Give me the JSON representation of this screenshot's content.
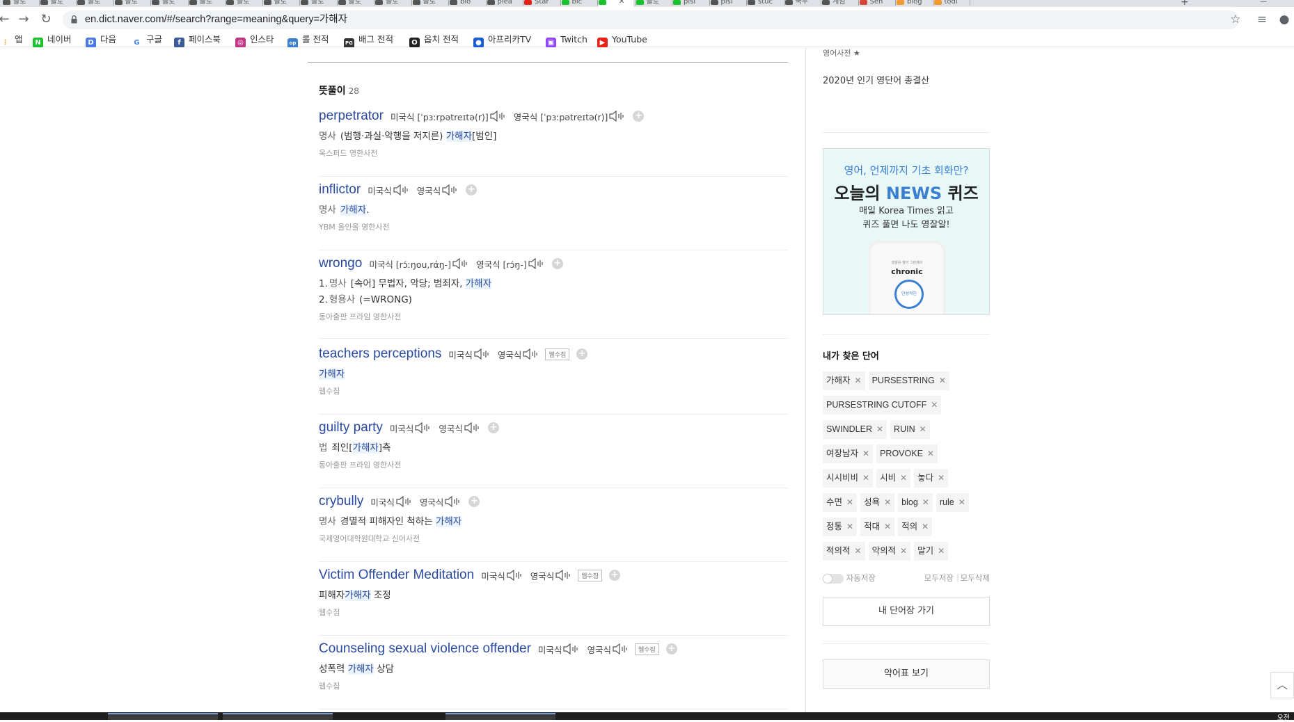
{
  "browser": {
    "tabs": [
      {
        "label": "블로",
        "color": "#555555"
      },
      {
        "label": "블로",
        "color": "#555555"
      },
      {
        "label": "블로",
        "color": "#555555"
      },
      {
        "label": "블로",
        "color": "#555555"
      },
      {
        "label": "블로",
        "color": "#555555"
      },
      {
        "label": "블로",
        "color": "#555555"
      },
      {
        "label": "블로",
        "color": "#555555"
      },
      {
        "label": "블로",
        "color": "#555555"
      },
      {
        "label": "블로",
        "color": "#555555"
      },
      {
        "label": "블로",
        "color": "#555555"
      },
      {
        "label": "블로",
        "color": "#555555"
      },
      {
        "label": "블로",
        "color": "#555555"
      },
      {
        "label": "blo",
        "color": "#555555"
      },
      {
        "label": "plea",
        "color": "#555555"
      },
      {
        "label": "Star",
        "color": "#e62117"
      },
      {
        "label": "blc",
        "color": "#19c22e"
      },
      {
        "label": "",
        "color": "#19c22e"
      },
      {
        "label": "블로",
        "color": "#19c22e"
      },
      {
        "label": "plsi",
        "color": "#19c22e"
      },
      {
        "label": "plsi",
        "color": "#555555"
      },
      {
        "label": "stuc",
        "color": "#555555"
      },
      {
        "label": "국무",
        "color": "#555555"
      },
      {
        "label": "계엄",
        "color": "#555555"
      },
      {
        "label": "Sen",
        "color": "#d44638"
      },
      {
        "label": "blog",
        "color": "#f29a2e"
      },
      {
        "label": "todi",
        "color": "#f29a2e"
      }
    ],
    "active_tab_index": 16,
    "url": "en.dict.naver.com/#/search?range=meaning&query=가해자",
    "bookmarks": [
      {
        "label": "앱",
        "icon": "apps-grid-icon",
        "color": "#e8a33d"
      },
      {
        "label": "네이버",
        "icon": "naver-icon",
        "color": "#19c22e"
      },
      {
        "label": "다음",
        "icon": "daum-icon",
        "color": "#4b7ae6"
      },
      {
        "label": "구글",
        "icon": "google-icon",
        "color": "#4285f4"
      },
      {
        "label": "페이스북",
        "icon": "facebook-icon",
        "color": "#3b5998"
      },
      {
        "label": "인스타",
        "icon": "instagram-icon",
        "color": "#c13584"
      },
      {
        "label": "롤 전적",
        "icon": "op-gg-icon",
        "color": "#3a7fd0"
      },
      {
        "label": "배그 전적",
        "icon": "pubg-icon",
        "color": "#333333"
      },
      {
        "label": "옵치 전적",
        "icon": "overwatch-icon",
        "color": "#222222"
      },
      {
        "label": "아프리카TV",
        "icon": "afreecatv-icon",
        "color": "#1a5cd7"
      },
      {
        "label": "Twitch",
        "icon": "twitch-icon",
        "color": "#9146ff"
      },
      {
        "label": "YouTube",
        "icon": "youtube-icon",
        "color": "#e62117"
      }
    ]
  },
  "results": {
    "section_title": "뜻풀이",
    "count": "28",
    "entries": [
      {
        "word": "perpetrator",
        "pron_us": "미국식 [ˈpɜːrpətreɪtə(r)]",
        "pron_uk": "영국식 [ˈpɜːpətreɪtə(r)]",
        "tag": "",
        "meanings": [
          {
            "num": "",
            "pos": "명사",
            "pre": "(범행·과실·악행을 저지른) ",
            "hl": "가해자",
            "post": "[범인]"
          }
        ],
        "source": "옥스퍼드 영한사전"
      },
      {
        "word": "inflictor",
        "pron_us": "미국식",
        "pron_uk": "영국식",
        "tag": "",
        "meanings": [
          {
            "num": "",
            "pos": "명사",
            "pre": "",
            "hl": "가해자",
            "post": "."
          }
        ],
        "source": "YBM 올인올 영한사전"
      },
      {
        "word": "wrongo",
        "pron_us": "미국식 [rɔ́ːŋou,rάŋ-]",
        "pron_uk": "영국식 [rɔ́ŋ-]",
        "tag": "",
        "meanings": [
          {
            "num": "1.",
            "pos": "명사",
            "pre": "[속어] 무법자, 악당; 범죄자, ",
            "hl": "가해자",
            "post": ""
          },
          {
            "num": "2.",
            "pos": "형용사",
            "pre": "(=WRONG)",
            "hl": "",
            "post": ""
          }
        ],
        "source": "동아출판 프라임 영한사전"
      },
      {
        "word": "teachers perceptions",
        "pron_us": "미국식",
        "pron_uk": "영국식",
        "tag": "웹수집",
        "meanings": [
          {
            "num": "",
            "pos": "",
            "pre": "",
            "hl": "가해자",
            "post": ""
          }
        ],
        "source": "웹수집"
      },
      {
        "word": "guilty party",
        "pron_us": "미국식",
        "pron_uk": "영국식",
        "tag": "",
        "meanings": [
          {
            "num": "",
            "pos": "법",
            "pre": "죄인[",
            "hl": "가해자",
            "post": "]측"
          }
        ],
        "source": "동아출판 프라임 영한사전"
      },
      {
        "word": "crybully",
        "pron_us": "미국식",
        "pron_uk": "영국식",
        "tag": "",
        "meanings": [
          {
            "num": "",
            "pos": "명사",
            "pre": "경멸적 피해자인 척하는 ",
            "hl": "가해자",
            "post": ""
          }
        ],
        "source": "국제영어대학원대학교 신어사전"
      },
      {
        "word": "Victim Offender Meditation",
        "pron_us": "미국식",
        "pron_uk": "영국식",
        "tag": "웹수집",
        "meanings": [
          {
            "num": "",
            "pos": "",
            "pre": "피해자",
            "hl": "가해자",
            "post": " 조정"
          }
        ],
        "source": "웹수집"
      },
      {
        "word": "Counseling sexual violence offender",
        "pron_us": "미국식",
        "pron_uk": "영국식",
        "tag": "웹수집",
        "meanings": [
          {
            "num": "",
            "pos": "",
            "pre": "성폭력 ",
            "hl": "가해자",
            "post": " 상담"
          }
        ],
        "source": "웹수집"
      }
    ]
  },
  "sidebar": {
    "top_cut_text": "영어사전 ★",
    "top_text": "2020년 인기 영단어 총결산",
    "ad": {
      "line1": "영어, 언제까지 기초 회화만?",
      "line2_pre": "오늘의 ",
      "line2_news": "NEWS",
      "line2_post": " 퀴즈",
      "line3a": "매일 Korea Times 읽고",
      "line3b": "퀴즈 풀면 나도 영잘알!",
      "phone_small": "잘알은 영어 그린재의",
      "phone_word": "chronic",
      "phone_circle": "만성적인"
    },
    "my_words_title": "내가 찾은 단어",
    "my_words": [
      "가해자",
      "PURSESTRING",
      "PURSESTRING CUTOFF",
      "SWINDLER",
      "RUIN",
      "여장남자",
      "PROVOKE",
      "시시비비",
      "시비",
      "놓다",
      "수면",
      "성욕",
      "blog",
      "rule",
      "정통",
      "적대",
      "적의",
      "적의적",
      "악의적",
      "말기"
    ],
    "auto_save": "자동저장",
    "save_all": "모두저장",
    "delete_all": "모두삭제",
    "go_wordbook": "내 단어장 가기",
    "abbrev_table": "약어표 보기"
  },
  "taskbar": {
    "clock": "오전"
  }
}
